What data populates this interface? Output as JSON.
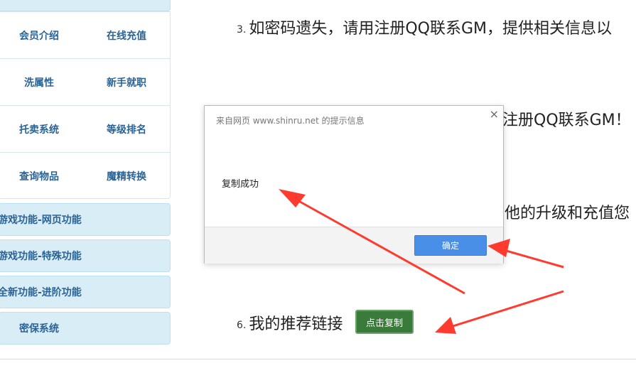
{
  "sidebar": {
    "grid": [
      [
        "会员介绍",
        "在线充值"
      ],
      [
        "洗属性",
        "新手就职"
      ],
      [
        "托卖系统",
        "等级排名"
      ],
      [
        "查询物品",
        "魔精转换"
      ]
    ],
    "buttons": [
      "游戏功能-网页功能",
      "游戏功能-特殊功能",
      "全新功能-进阶功能",
      "密保系统"
    ]
  },
  "main": {
    "line3": {
      "num": "3.",
      "text": "如密码遗失，请用注册QQ联系GM，提供相关信息以"
    },
    "line4_tail": "注册QQ联系GM！",
    "line5_tail": "他的升级和充值您",
    "line6": {
      "num": "6.",
      "text": "我的推荐链接"
    },
    "copy_button": "点击复制"
  },
  "dialog": {
    "title": "来自网页 www.shinru.net 的提示信息",
    "close": "×",
    "message": "复制成功",
    "ok": "确定"
  },
  "colors": {
    "arrow": "#ff3b30",
    "sidebar_bg": "#d9edf7",
    "sidebar_text": "#2a6496",
    "ok_button": "#4a8fe7",
    "copy_button": "#3a7a3a"
  }
}
